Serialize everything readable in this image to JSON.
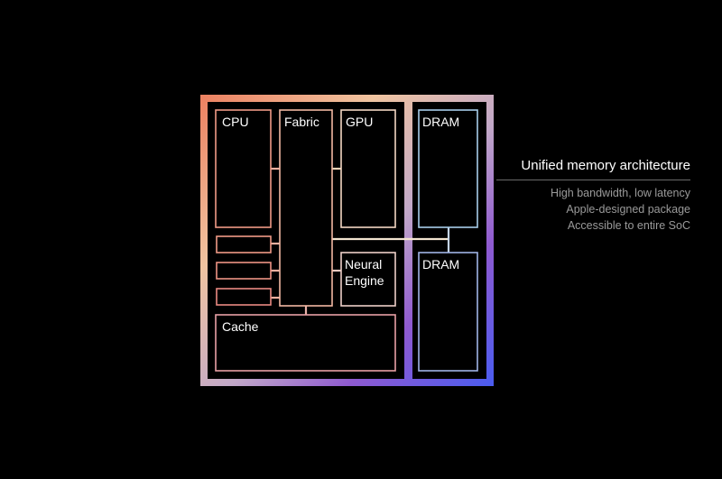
{
  "colors": {
    "background": "#000000",
    "gradient_top": [
      "#e9735c",
      "#f2c7a5",
      "#9ec7e3",
      "#4a9af4"
    ],
    "gradient_bottom": [
      "#e6405c",
      "#b43a8a",
      "#6a3ad0",
      "#4a46e6"
    ],
    "text": "#ffffff",
    "subtext": "#9a9a9a"
  },
  "diagram": {
    "blocks": {
      "cpu": "CPU",
      "fabric": "Fabric",
      "gpu": "GPU",
      "neural_line1": "Neural",
      "neural_line2": "Engine",
      "cache": "Cache",
      "dram_top": "DRAM",
      "dram_bottom": "DRAM"
    }
  },
  "side_panel": {
    "title": "Unified memory architecture",
    "features": [
      "High bandwidth, low latency",
      "Apple-designed package",
      "Accessible to entire SoC"
    ]
  }
}
